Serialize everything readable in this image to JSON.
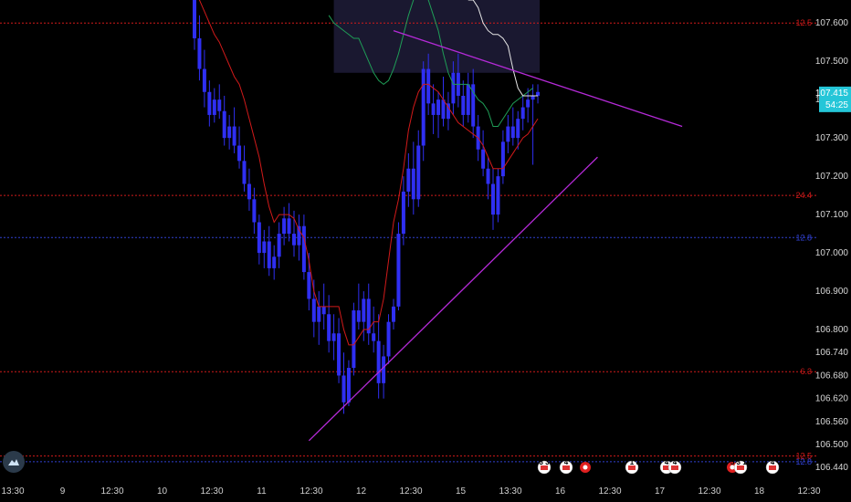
{
  "colors": {
    "background": "#000000",
    "candle": "#2f2ff2",
    "red_line": "#d11a1a",
    "green_line": "#1f9e57",
    "white_line": "#e6e6e6",
    "trendline": "#b52ad8",
    "level_red": "#d11a1a",
    "level_blue": "#3040d0",
    "cloud": "#1a1830",
    "price_tag": "#24c6d8"
  },
  "price_axis": {
    "labels": [
      "107.600",
      "107.500",
      "107.400",
      "107.300",
      "107.200",
      "107.100",
      "107.000",
      "106.900",
      "106.800",
      "106.740",
      "106.680",
      "106.620",
      "106.560",
      "106.500",
      "106.440"
    ]
  },
  "time_axis": {
    "labels": [
      "13:30",
      "9",
      "12:30",
      "10",
      "12:30",
      "11",
      "12:30",
      "12",
      "12:30",
      "15",
      "13:30",
      "16",
      "12:30",
      "17",
      "12:30",
      "18",
      "12:30"
    ]
  },
  "price_tag": {
    "price": "107.415",
    "countdown": "54:25"
  },
  "levels": [
    {
      "label": "12.5",
      "price": 107.6,
      "color": "red"
    },
    {
      "label": "24.4",
      "price": 107.15,
      "color": "red"
    },
    {
      "label": "12.8",
      "price": 107.04,
      "color": "blue"
    },
    {
      "label": "6.3",
      "price": 106.69,
      "color": "red"
    },
    {
      "label": "12.5",
      "price": 106.47,
      "color": "red"
    },
    {
      "label": "12.8",
      "price": 106.455,
      "color": "blue"
    }
  ],
  "events": [
    {
      "label": "3 3",
      "kind": "flag"
    },
    {
      "label": "4",
      "kind": "flag"
    },
    {
      "label": "",
      "kind": "circle"
    },
    {
      "label": "7 1 3",
      "kind": "flag"
    },
    {
      "label": "4",
      "kind": "flag"
    },
    {
      "label": "4",
      "kind": "flag"
    },
    {
      "label": "",
      "kind": "circle"
    },
    {
      "label": "5 3 10",
      "kind": "flag"
    },
    {
      "label": "4",
      "kind": "flag"
    }
  ],
  "logo_icon": "tradingview-cloud-icon",
  "chart_data": {
    "type": "line",
    "symbol": "",
    "title": "",
    "xlabel": "",
    "ylabel": "",
    "ylim": [
      106.44,
      107.66
    ],
    "grid": false,
    "candles": [
      [
        107.66,
        107.72,
        107.53,
        107.56
      ],
      [
        107.56,
        107.62,
        107.45,
        107.48
      ],
      [
        107.48,
        107.53,
        107.38,
        107.42
      ],
      [
        107.42,
        107.45,
        107.33,
        107.36
      ],
      [
        107.36,
        107.43,
        107.34,
        107.4
      ],
      [
        107.4,
        107.44,
        107.35,
        107.37
      ],
      [
        107.37,
        107.41,
        107.28,
        107.3
      ],
      [
        107.3,
        107.36,
        107.27,
        107.33
      ],
      [
        107.33,
        107.38,
        107.26,
        107.28
      ],
      [
        107.28,
        107.33,
        107.22,
        107.24
      ],
      [
        107.24,
        107.28,
        107.16,
        107.18
      ],
      [
        107.18,
        107.22,
        107.11,
        107.14
      ],
      [
        107.14,
        107.17,
        107.05,
        107.08
      ],
      [
        107.08,
        107.1,
        106.97,
        107.0
      ],
      [
        107.0,
        107.06,
        106.96,
        107.03
      ],
      [
        107.03,
        107.07,
        106.94,
        106.96
      ],
      [
        106.96,
        107.02,
        106.93,
        106.99
      ],
      [
        106.99,
        107.08,
        106.96,
        107.05
      ],
      [
        107.05,
        107.12,
        107.02,
        107.09
      ],
      [
        107.09,
        107.13,
        107.03,
        107.05
      ],
      [
        107.05,
        107.11,
        106.99,
        107.02
      ],
      [
        107.02,
        107.1,
        106.98,
        107.07
      ],
      [
        107.07,
        107.1,
        106.93,
        106.95
      ],
      [
        106.95,
        107.0,
        106.85,
        106.88
      ],
      [
        106.88,
        106.93,
        106.78,
        106.82
      ],
      [
        106.82,
        106.9,
        106.76,
        106.86
      ],
      [
        106.86,
        106.92,
        106.8,
        106.84
      ],
      [
        106.84,
        106.89,
        106.74,
        106.77
      ],
      [
        106.77,
        106.84,
        106.72,
        106.79
      ],
      [
        106.79,
        106.83,
        106.66,
        106.68
      ],
      [
        106.68,
        106.74,
        106.58,
        106.61
      ],
      [
        106.61,
        106.72,
        106.6,
        106.7
      ],
      [
        106.7,
        106.87,
        106.68,
        106.85
      ],
      [
        106.85,
        106.92,
        106.8,
        106.82
      ],
      [
        106.82,
        106.9,
        106.77,
        106.88
      ],
      [
        106.88,
        106.92,
        106.76,
        106.79
      ],
      [
        106.79,
        106.86,
        106.74,
        106.77
      ],
      [
        106.77,
        106.84,
        106.62,
        106.66
      ],
      [
        106.66,
        106.76,
        106.62,
        106.73
      ],
      [
        106.73,
        106.84,
        106.71,
        106.82
      ],
      [
        106.82,
        106.88,
        106.8,
        106.86
      ],
      [
        106.86,
        107.08,
        106.85,
        107.05
      ],
      [
        107.05,
        107.2,
        107.02,
        107.16
      ],
      [
        107.16,
        107.26,
        107.12,
        107.22
      ],
      [
        107.22,
        107.29,
        107.1,
        107.14
      ],
      [
        107.14,
        107.32,
        107.12,
        107.28
      ],
      [
        107.28,
        107.5,
        107.24,
        107.48
      ],
      [
        107.48,
        107.52,
        107.36,
        107.39
      ],
      [
        107.39,
        107.44,
        107.31,
        107.36
      ],
      [
        107.36,
        107.42,
        107.3,
        107.4
      ],
      [
        107.4,
        107.46,
        107.33,
        107.35
      ],
      [
        107.35,
        107.42,
        107.32,
        107.39
      ],
      [
        107.39,
        107.5,
        107.36,
        107.47
      ],
      [
        107.47,
        107.52,
        107.38,
        107.41
      ],
      [
        107.41,
        107.45,
        107.33,
        107.36
      ],
      [
        107.36,
        107.47,
        107.34,
        107.44
      ],
      [
        107.44,
        107.48,
        107.3,
        107.33
      ],
      [
        107.33,
        107.36,
        107.24,
        107.27
      ],
      [
        107.27,
        107.32,
        107.2,
        107.22
      ],
      [
        107.22,
        107.25,
        107.14,
        107.18
      ],
      [
        107.18,
        107.22,
        107.06,
        107.1
      ],
      [
        107.1,
        107.22,
        107.08,
        107.2
      ],
      [
        107.2,
        107.32,
        107.18,
        107.29
      ],
      [
        107.29,
        107.36,
        107.26,
        107.33
      ],
      [
        107.33,
        107.38,
        107.28,
        107.3
      ],
      [
        107.3,
        107.37,
        107.27,
        107.35
      ],
      [
        107.35,
        107.41,
        107.32,
        107.38
      ],
      [
        107.38,
        107.43,
        107.34,
        107.4
      ],
      [
        107.4,
        107.44,
        107.23,
        107.41
      ],
      [
        107.41,
        107.44,
        107.39,
        107.42
      ]
    ],
    "red_line": [
      107.7,
      107.66,
      107.63,
      107.6,
      107.57,
      107.55,
      107.52,
      107.49,
      107.46,
      107.44,
      107.4,
      107.35,
      107.3,
      107.25,
      107.18,
      107.12,
      107.08,
      107.1,
      107.1,
      107.1,
      107.09,
      107.06,
      107.04,
      106.98,
      106.9,
      106.86,
      106.86,
      106.86,
      106.86,
      106.86,
      106.8,
      106.76,
      106.76,
      106.78,
      106.8,
      106.8,
      106.82,
      106.82,
      106.88,
      106.98,
      107.08,
      107.14,
      107.22,
      107.32,
      107.38,
      107.42,
      107.44,
      107.44,
      107.43,
      107.42,
      107.4,
      107.38,
      107.36,
      107.34,
      107.33,
      107.32,
      107.31,
      107.3,
      107.28,
      107.25,
      107.22,
      107.22,
      107.22,
      107.24,
      107.26,
      107.28,
      107.3,
      107.31,
      107.33,
      107.35
    ],
    "green_line_segment": {
      "start_index": 27,
      "values": [
        107.62,
        107.6,
        107.59,
        107.58,
        107.57,
        107.56,
        107.56,
        107.53,
        107.5,
        107.47,
        107.45,
        107.44,
        107.45,
        107.48,
        107.52,
        107.57,
        107.62,
        107.66,
        107.68,
        107.67,
        107.66,
        107.62,
        107.58,
        107.52,
        107.47,
        107.44,
        107.44,
        107.44,
        107.44,
        107.42,
        107.4,
        107.39,
        107.37,
        107.33,
        107.33,
        107.35,
        107.37,
        107.39,
        107.4,
        107.41,
        107.42,
        107.43
      ]
    },
    "white_line_segment": {
      "start_index": 55,
      "values": [
        107.66,
        107.66,
        107.64,
        107.6,
        107.58,
        107.57,
        107.57,
        107.56,
        107.54,
        107.48,
        107.43,
        107.41,
        107.41,
        107.41,
        107.41
      ]
    },
    "trendlines": [
      {
        "from": [
          40,
          107.58
        ],
        "to": [
          98,
          107.33
        ]
      },
      {
        "from": [
          23,
          106.51
        ],
        "to": [
          81,
          107.25
        ]
      }
    ]
  }
}
